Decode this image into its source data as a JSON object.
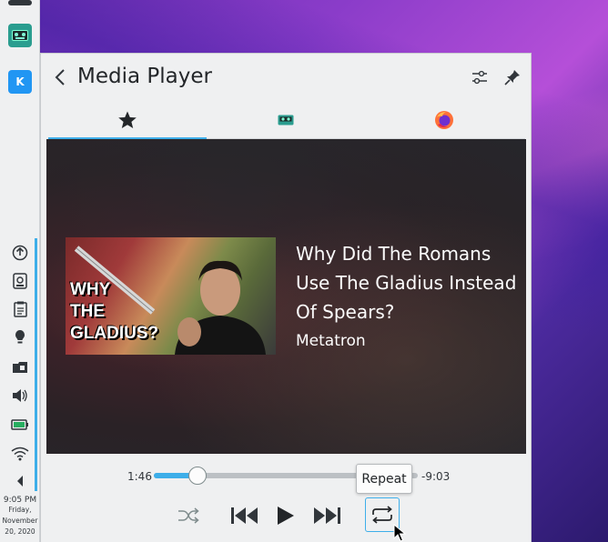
{
  "window": {
    "title": "Media Player"
  },
  "panel": {
    "tasks": [
      {
        "name": "tape-app",
        "color": "#2a9d8f"
      },
      {
        "name": "kde-connect-app",
        "color": "#2196f3",
        "label": "K"
      }
    ],
    "tray_icons": [
      "update-icon",
      "disk-icon",
      "clipboard-icon",
      "notification-icon",
      "vault-icon",
      "volume-icon",
      "battery-icon",
      "network-icon",
      "expand-icon"
    ],
    "clock": {
      "time": "9:05 PM",
      "day": "Friday,",
      "date_line1": "November",
      "date_line2": "20, 2020"
    }
  },
  "header": {
    "back_label": "‹",
    "title": "Media Player"
  },
  "tabs": [
    {
      "name": "tab-favorites",
      "icon": "star-icon",
      "active": true
    },
    {
      "name": "tab-tape-player",
      "icon": "tape-icon",
      "active": false
    },
    {
      "name": "tab-firefox",
      "icon": "firefox-icon",
      "active": false
    }
  ],
  "track": {
    "title": "Why Did The Romans Use The Gladius Instead Of Spears?",
    "artist": "Metatron",
    "thumbnail_text": "WHY\nTHE\nGLADIUS?",
    "elapsed": "1:46",
    "remaining": "-9:03",
    "progress_fraction": 0.164
  },
  "controls": {
    "shuffle": "shuffle-icon",
    "previous": "previous-icon",
    "play": "play-icon",
    "next": "next-icon",
    "repeat": "repeat-icon"
  },
  "tooltip": {
    "text": "Repeat"
  },
  "colors": {
    "accent": "#3daee9",
    "panel_bg": "#eff0f1",
    "text": "#232629"
  }
}
